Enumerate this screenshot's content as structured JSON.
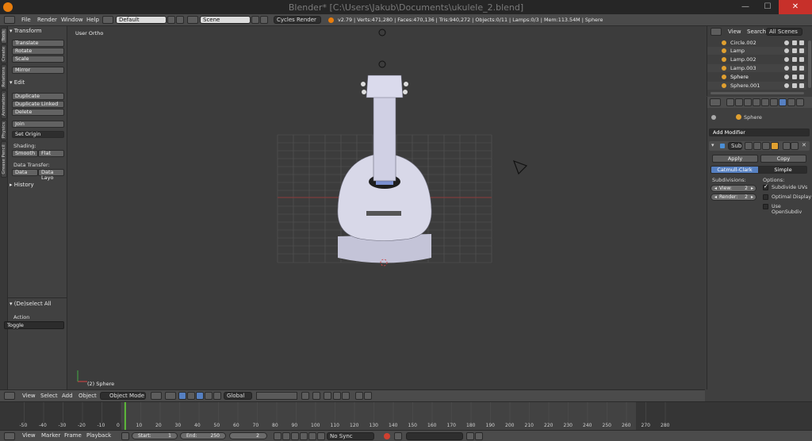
{
  "window": {
    "title": "Blender* [C:\\Users\\Jakub\\Documents\\ukulele_2.blend]",
    "minimize": "—",
    "maximize": "☐",
    "close": "✕"
  },
  "info_header": {
    "menus": [
      "File",
      "Render",
      "Window",
      "Help"
    ],
    "screen_layout": "Default",
    "scene": "Scene",
    "render_engine": "Cycles Render",
    "stats": "v2.79 | Verts:471,280 | Faces:470,136 | Tris:940,272 | Objects:0/11 | Lamps:0/3 | Mem:113.54M | Sphere"
  },
  "tool_tabs": [
    "Tools",
    "Create",
    "Relations",
    "Animation",
    "Physics",
    "Grease Pencil"
  ],
  "tool_shelf": {
    "transform_header": "Transform",
    "transform_buttons": [
      "Translate",
      "Rotate",
      "Scale"
    ],
    "mirror": "Mirror",
    "edit_header": "Edit",
    "edit_buttons": [
      "Duplicate",
      "Duplicate Linked",
      "Delete"
    ],
    "join": "Join",
    "set_origin": "Set Origin",
    "shading_label": "Shading:",
    "smooth": "Smooth",
    "flat": "Flat",
    "data_transfer_label": "Data Transfer:",
    "data": "Data",
    "data_layout": "Data Layo",
    "history_header": "History"
  },
  "operator_panel": {
    "header": "(De)select All",
    "action_label": "Action",
    "action_value": "Toggle"
  },
  "viewport": {
    "view_label": "User Ortho",
    "object_label": "(2) Sphere"
  },
  "outliner": {
    "tabs": [
      "View",
      "Search",
      "All Scenes"
    ],
    "items": [
      "Circle.002",
      "Lamp",
      "Lamp.002",
      "Lamp.003",
      "Sphere",
      "Sphere.001"
    ]
  },
  "properties": {
    "breadcrumb_object": "Sphere",
    "add_modifier": "Add Modifier",
    "modifier_name": "Sub",
    "apply": "Apply",
    "copy": "Copy",
    "catmull_clark": "Catmull-Clark",
    "simple": "Simple",
    "subdivisions_label": "Subdivisions:",
    "options_label": "Options:",
    "view_label": "View:",
    "view_value": "2",
    "render_label": "Render:",
    "render_value": "2",
    "subdivide_uvs": "Subdivide UVs",
    "optimal_display": "Optimal Display",
    "use_opensubdiv": "Use OpenSubdiv",
    "subdivide_uvs_checked": true,
    "optimal_display_checked": false,
    "use_opensubdiv_checked": false
  },
  "view_header": {
    "menus": [
      "View",
      "Select",
      "Add",
      "Object"
    ],
    "mode": "Object Mode",
    "orientation": "Global"
  },
  "timeline": {
    "ticks": [
      "-50",
      "-40",
      "-30",
      "-20",
      "-10",
      "0",
      "10",
      "20",
      "30",
      "40",
      "50",
      "60",
      "70",
      "80",
      "90",
      "100",
      "110",
      "120",
      "130",
      "140",
      "150",
      "160",
      "170",
      "180",
      "190",
      "200",
      "210",
      "220",
      "230",
      "240",
      "250",
      "260",
      "270",
      "280"
    ],
    "current_frame_marker": 2
  },
  "timeline_header": {
    "menus": [
      "View",
      "Marker",
      "Frame",
      "Playback"
    ],
    "start_label": "Start:",
    "start_value": "1",
    "end_label": "End:",
    "end_value": "250",
    "current_frame": "2",
    "sync": "No Sync"
  }
}
